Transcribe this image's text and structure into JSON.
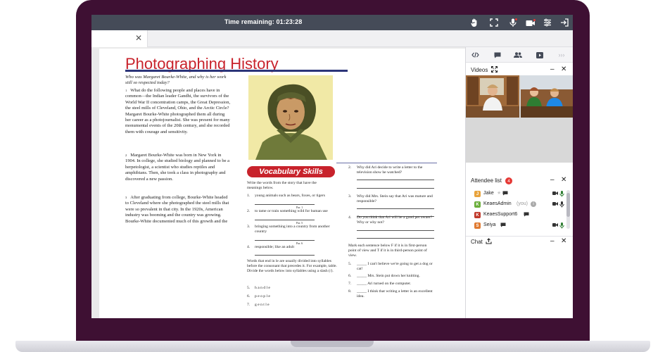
{
  "header": {
    "timer_label": "Time remaining:",
    "timer_value": "01:23:28",
    "icons": [
      "hand-icon",
      "fullscreen-icon",
      "microphone-icon",
      "camera-icon",
      "settings-icon",
      "exit-icon"
    ]
  },
  "document": {
    "title": "Photographing History",
    "intro_question": "Who was Margaret Bourke-White, and why is her work still so respected today?",
    "paragraphs": [
      {
        "num": "1",
        "text": "What do the following people and places have in common—the Indian leader Gandhi, the survivors of the World War II concentration camps, the Great Depression, the steel mills of Cleveland, Ohio, and the Arctic Circle? Margaret Bourke-White photographed them all during her career as a photojournalist. She was present for many monumental events of the 20th century, and she recorded them with courage and sensitivity."
      },
      {
        "num": "2",
        "text": "Margaret Bourke-White was born in New York in 1904. In college, she studied biology and planned to be a herpetologist, a scientist who studies reptiles and amphibians. Then, she took a class in photography and discovered a new passion."
      },
      {
        "num": "3",
        "text": "After graduating from college, Bourke-White headed to Cleveland where she photographed the steel mills that were so prevalent in that city. In the 1920s, American industry was booming and the country was growing. Bourke-White documented much of this growth and the"
      }
    ],
    "vocab_title": "Vocabulary Skills",
    "vocab_intro": "Write the words from the story that have the meanings below.",
    "vocab_items": [
      {
        "n": "1.",
        "text": "young animals such as bears, foxes, or tigers",
        "hint": ""
      },
      {
        "n": "2.",
        "text": "to tame or train something wild for human use",
        "hint": "Par. 1"
      },
      {
        "n": "3.",
        "text": "bringing something into a country from another country",
        "hint": "Par. 5"
      },
      {
        "n": "4.",
        "text": "responsible; like an adult",
        "hint": "Par. 6"
      }
    ],
    "syllable_intro": "Words that end in le are usually divided into syllables before the consonant that precedes it. For example, table. Divide the words below into syllables using a slash (/).",
    "syllable_items": [
      {
        "n": "5.",
        "word": "h a n d l e"
      },
      {
        "n": "6.",
        "word": "p e o p l e"
      },
      {
        "n": "7.",
        "word": "g e n t l e"
      }
    ],
    "questions": [
      {
        "n": "2.",
        "text": "Why did Ari decide to write a letter to the television show he watched?"
      },
      {
        "n": "3.",
        "text": "Why did Mrs. Stein say that Ari was mature and responsible?"
      },
      {
        "n": "4.",
        "text": "Do you think that Ari will be a good pet owner? Why or why not?"
      }
    ],
    "pov_intro": "Mark each sentence below F if it is in first-person point of view and T if it is in third-person point of view.",
    "pov_items": [
      {
        "n": "5.",
        "text": "_____ I can't believe we're going to get a dog or cat!"
      },
      {
        "n": "6.",
        "text": "_____ Mrs. Stein put down her knitting."
      },
      {
        "n": "7.",
        "text": "_____ Ari turned on the computer."
      },
      {
        "n": "8.",
        "text": "_____ I think that writing a letter is an excellent idea."
      }
    ]
  },
  "sidebar": {
    "tab_icons": [
      "code-icon",
      "chat-icon",
      "people-icon",
      "video-play-icon",
      "more-icon"
    ],
    "videos_title": "Videos",
    "attendee_title": "Attendee list",
    "attendee_count": "4",
    "chat_title": "Chat",
    "attendees": [
      {
        "initial": "J",
        "name": "Jake",
        "suffix": "",
        "color": "#e8a33c"
      },
      {
        "initial": "K",
        "name": "KeaesAdmin",
        "suffix": "(you)",
        "color": "#6aae3a"
      },
      {
        "initial": "K",
        "name": "KeaesSupport6",
        "suffix": "",
        "color": "#c0392b"
      },
      {
        "initial": "S",
        "name": "Seiya",
        "suffix": "",
        "color": "#e07a30"
      }
    ]
  },
  "colors": {
    "accent": "#c8232c",
    "topbar": "#454b58",
    "lid": "#3e1033"
  }
}
